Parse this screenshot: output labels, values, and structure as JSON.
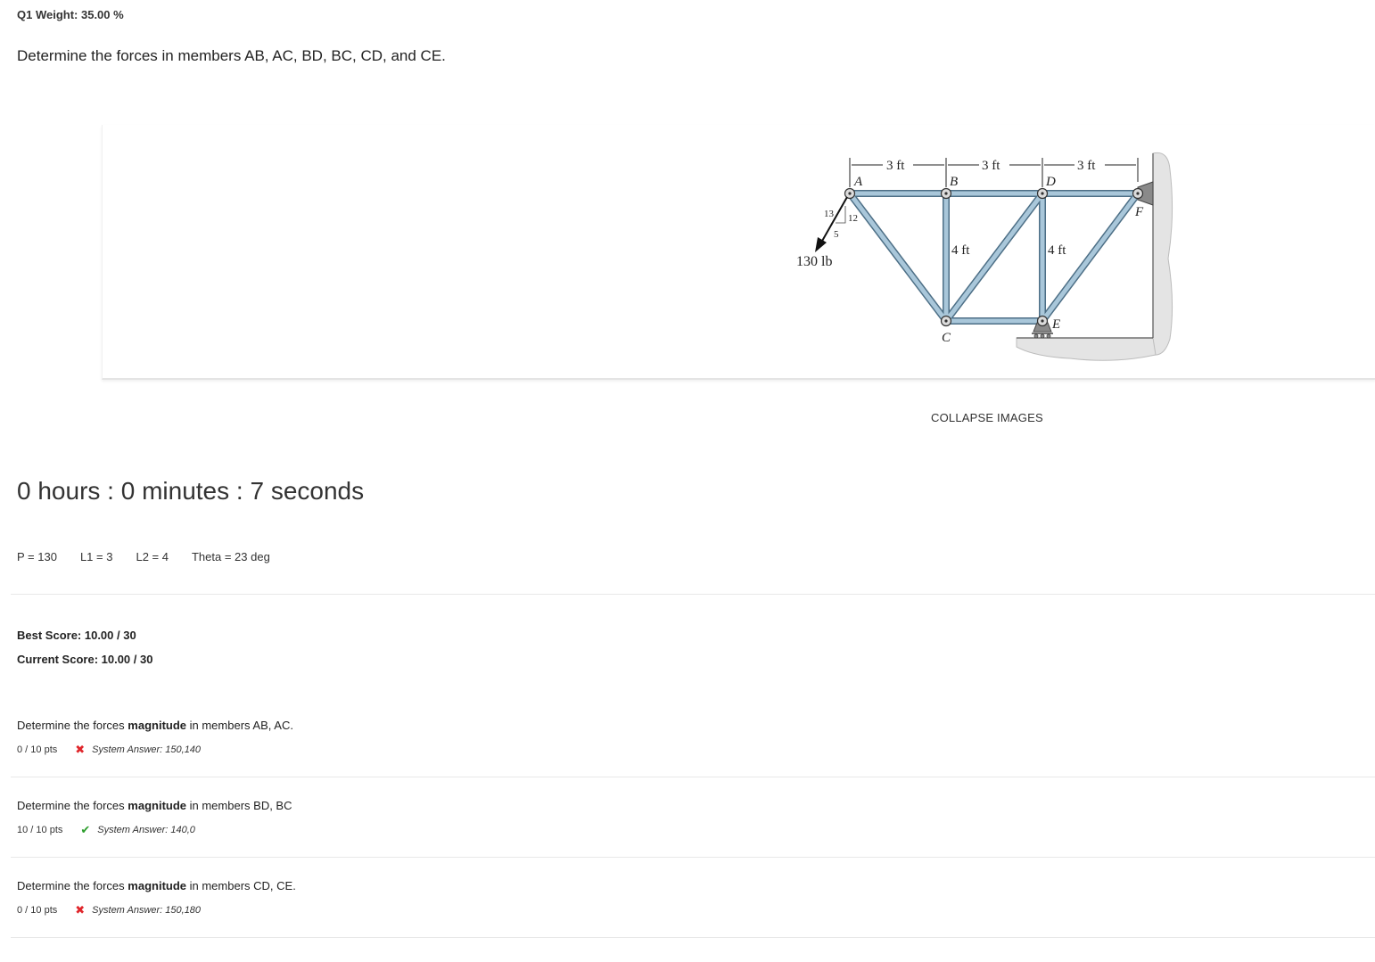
{
  "header": {
    "weight": "Q1 Weight: 35.00 %",
    "question": "Determine the forces in members AB, AC, BD, BC, CD, and CE."
  },
  "figure": {
    "dim_labels": [
      "3 ft",
      "3 ft",
      "3 ft"
    ],
    "height_labels": [
      "4 ft",
      "4 ft"
    ],
    "joints": [
      "A",
      "B",
      "D",
      "F",
      "C",
      "E"
    ],
    "slope": [
      "13",
      "12",
      "5"
    ],
    "load": "130 lb",
    "collapse_label": "COLLAPSE IMAGES"
  },
  "timer": "0 hours : 0 minutes : 7 seconds",
  "params": {
    "p": "P = 130",
    "l1": "L1 = 3",
    "l2": "L2 = 4",
    "theta": "Theta = 23 deg"
  },
  "scores": {
    "best": "Best Score: 10.00 / 30",
    "current": "Current Score: 10.00 / 30"
  },
  "parts": [
    {
      "q_before": "Determine the forces ",
      "q_bold": "magnitude",
      "q_after": " in members AB, AC.",
      "pts": "0 / 10 pts",
      "mark": "✖",
      "system": "System Answer: 150,140"
    },
    {
      "q_before": "Determine the forces ",
      "q_bold": "magnitude",
      "q_after": " in members BD, BC",
      "pts": "10 / 10 pts",
      "mark": "✔",
      "system": "System Answer: 140,0"
    },
    {
      "q_before": "Determine the forces ",
      "q_bold": "magnitude",
      "q_after": " in members CD, CE.",
      "pts": "0 / 10 pts",
      "mark": "✖",
      "system": "System Answer: 150,180"
    }
  ],
  "colors": {
    "member": "#9fbfd3",
    "member_edge": "#4d6f86",
    "incorrect": "#e0262b",
    "correct": "#2e9e2e"
  }
}
